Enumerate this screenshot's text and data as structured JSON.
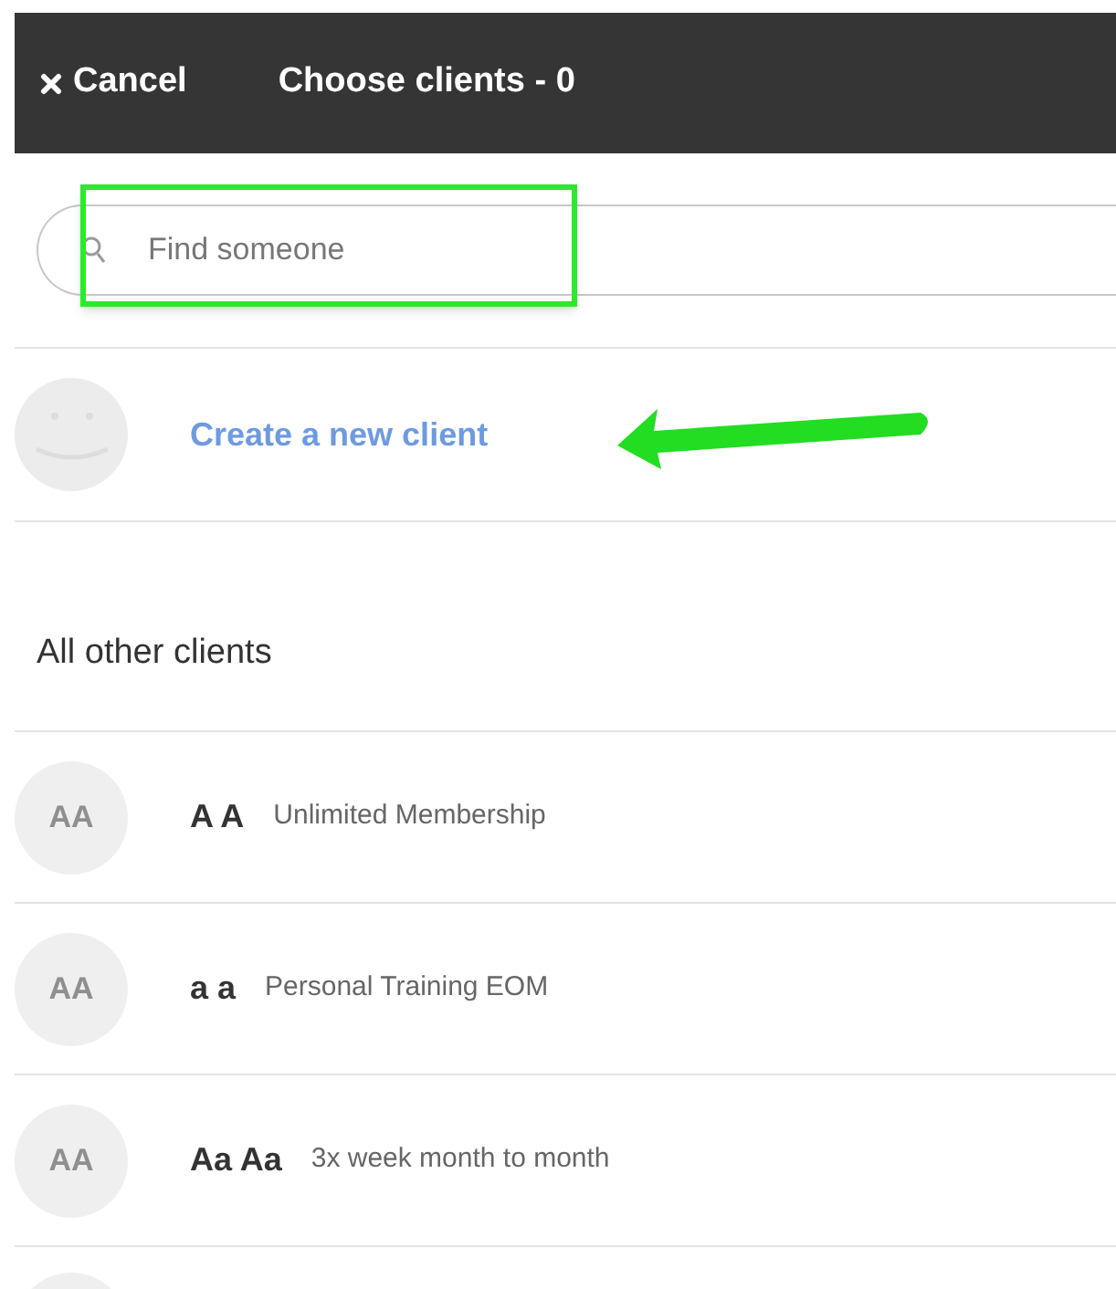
{
  "header": {
    "cancel": "Cancel",
    "title": "Choose clients - 0"
  },
  "search": {
    "placeholder": "Find someone"
  },
  "create": {
    "label": "Create a new client"
  },
  "section": {
    "title": "All other clients"
  },
  "clients": [
    {
      "initials": "AA",
      "name": "A A",
      "plan": "Unlimited Membership"
    },
    {
      "initials": "AA",
      "name": "a a",
      "plan": "Personal Training EOM"
    },
    {
      "initials": "AA",
      "name": "Aa Aa",
      "plan": "3x week month to month"
    }
  ]
}
